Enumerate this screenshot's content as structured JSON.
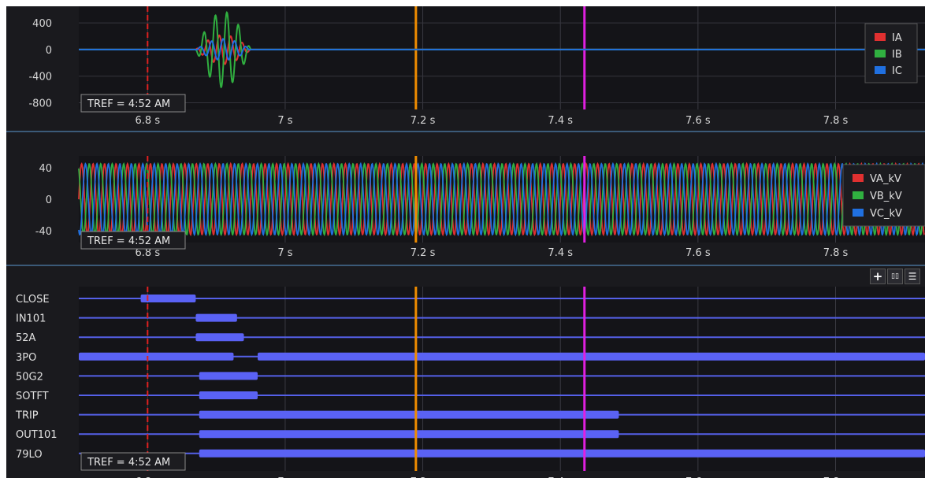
{
  "tref_label": "TREF = 4:52 AM",
  "time_axis": {
    "ticks": [
      {
        "t": 6.8,
        "label": "6.8 s"
      },
      {
        "t": 7.0,
        "label": "7 s"
      },
      {
        "t": 7.2,
        "label": "7.2 s"
      },
      {
        "t": 7.4,
        "label": "7.4 s"
      },
      {
        "t": 7.6,
        "label": "7.6 s"
      },
      {
        "t": 7.8,
        "label": "7.8 s"
      }
    ],
    "range": [
      6.7,
      7.93
    ]
  },
  "cursors": [
    {
      "name": "reference-cursor",
      "t": 6.8,
      "color": "#e02020",
      "style": "dashed"
    },
    {
      "name": "orange-cursor",
      "t": 7.19,
      "color": "#f08c00",
      "style": "solid"
    },
    {
      "name": "magenta-cursor",
      "t": 7.435,
      "color": "#e020e0",
      "style": "solid"
    }
  ],
  "current_chart": {
    "y_ticks": [
      "400",
      "0",
      "-400",
      "-800"
    ],
    "y_values": [
      400,
      0,
      -400,
      -800
    ],
    "legend": [
      {
        "label": "IA",
        "color": "#e03030"
      },
      {
        "label": "IB",
        "color": "#30b040"
      },
      {
        "label": "IC",
        "color": "#2070e0"
      }
    ],
    "chart_data": {
      "type": "line",
      "ylim": [
        -900,
        650
      ],
      "fault_window_s": [
        6.87,
        6.95
      ],
      "series": [
        {
          "name": "IA",
          "peak": 220
        },
        {
          "name": "IB",
          "peak": 570
        },
        {
          "name": "IC",
          "peak": 160
        }
      ]
    }
  },
  "voltage_chart": {
    "y_ticks": [
      "40",
      "0",
      "-40"
    ],
    "y_values": [
      40,
      0,
      -40
    ],
    "legend": [
      {
        "label": "VA_kV",
        "color": "#e03030"
      },
      {
        "label": "VB_kV",
        "color": "#30b040"
      },
      {
        "label": "VC_kV",
        "color": "#2070e0"
      }
    ],
    "chart_data": {
      "type": "line",
      "ylim": [
        -55,
        55
      ],
      "amplitude_kV": 45,
      "frequency_hz": 60,
      "series": [
        {
          "name": "VA_kV"
        },
        {
          "name": "VB_kV"
        },
        {
          "name": "VC_kV"
        }
      ]
    }
  },
  "toolbar": {
    "add": "+",
    "split_h": "▯▯",
    "split_v": "☰"
  },
  "digital_chart": {
    "chart_data": {
      "type": "timeline",
      "signals": [
        {
          "name": "CLOSE",
          "on": [
            [
              6.79,
              6.87
            ]
          ]
        },
        {
          "name": "IN101",
          "on": [
            [
              6.87,
              6.93
            ]
          ]
        },
        {
          "name": "52A",
          "on": [
            [
              6.87,
              6.94
            ]
          ]
        },
        {
          "name": "3PO",
          "on": [
            [
              6.7,
              6.925
            ],
            [
              6.96,
              7.93
            ]
          ]
        },
        {
          "name": "50G2",
          "on": [
            [
              6.875,
              6.96
            ]
          ]
        },
        {
          "name": "SOTFT",
          "on": [
            [
              6.875,
              6.96
            ]
          ]
        },
        {
          "name": "TRIP",
          "on": [
            [
              6.875,
              7.485
            ]
          ]
        },
        {
          "name": "OUT101",
          "on": [
            [
              6.875,
              7.485
            ]
          ]
        },
        {
          "name": "79LO",
          "on": [
            [
              6.875,
              7.93
            ]
          ]
        }
      ]
    }
  }
}
